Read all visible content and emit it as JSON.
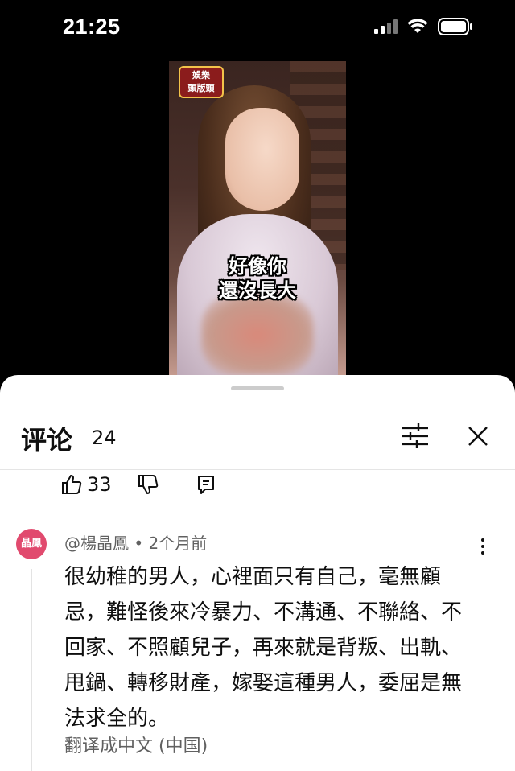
{
  "status_bar": {
    "time": "21:25"
  },
  "video": {
    "logo_line1": "娛樂",
    "logo_line2": "頭版頭",
    "subtitle_line1": "好像你",
    "subtitle_line2": "還沒長大"
  },
  "comments_sheet": {
    "title": "评论",
    "count": "24",
    "prev_comment": {
      "like_count": "33"
    },
    "comment": {
      "avatar_text": "晶鳳",
      "author_time": "@楊晶鳳 • 2个月前",
      "text": "很幼稚的男人，心裡面只有自己，毫無顧忌，難怪後來冷暴力、不溝通、不聯絡、不回家、不照顧兒子，再來就是背叛、出軌、甩鍋、轉移財產，嫁娶這種男人，委屈是無法求全的。",
      "translate_label": "翻译成中文 (中国)"
    }
  }
}
